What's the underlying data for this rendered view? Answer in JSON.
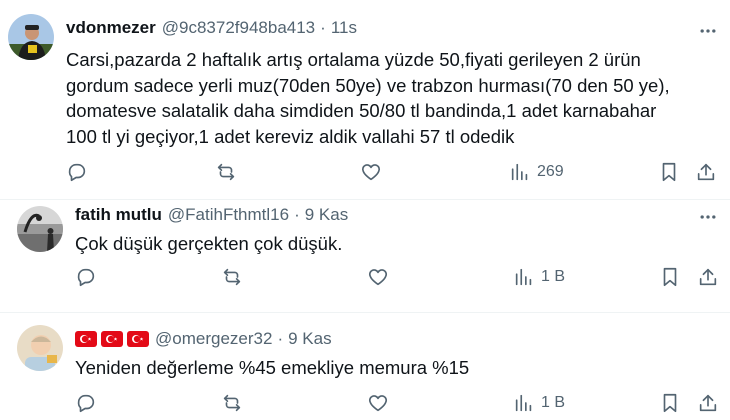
{
  "tweets": [
    {
      "name": "vdonmezer",
      "handle": "@9c8372f948ba413",
      "separator": "·",
      "time": "11s",
      "lines": [
        "Carsi,pazarda 2 haftalık artış ortalama yüzde 50,fiyati gerileyen 2 ürün",
        "gordum sadece yerli muz(70den 50ye) ve trabzon hurması(70 den 50 ye),",
        "domatesve salatalik daha simdiden 50/80 tl bandinda,1 adet karnabahar",
        "100 tl yi geçiyor,1 adet kereviz aldik vallahi 57 tl odedik"
      ],
      "views": "269",
      "icons": [
        "reply-icon",
        "retweet-icon",
        "like-icon",
        "views-icon",
        "bookmark-icon",
        "share-icon",
        "more-icon"
      ]
    },
    {
      "name": "fatih mutlu",
      "handle": "@FatihFthmtl16",
      "separator": "·",
      "time": "9 Kas",
      "lines": [
        "Çok düşük gerçekten çok düşük."
      ],
      "views": "1 B"
    },
    {
      "name": "",
      "name_flags": [
        "turkish-flag-icon",
        "turkish-flag-icon",
        "turkish-flag-icon"
      ],
      "handle": "@omergezer32",
      "separator": "·",
      "time": "9 Kas",
      "lines": [
        "Yeniden değerleme %45 emekliye memura %15"
      ],
      "views": "1 B"
    }
  ],
  "colors": {
    "text": "#0f1419",
    "secondary": "#536471",
    "divider": "#eff3f4",
    "flag_red": "#e30a17"
  }
}
